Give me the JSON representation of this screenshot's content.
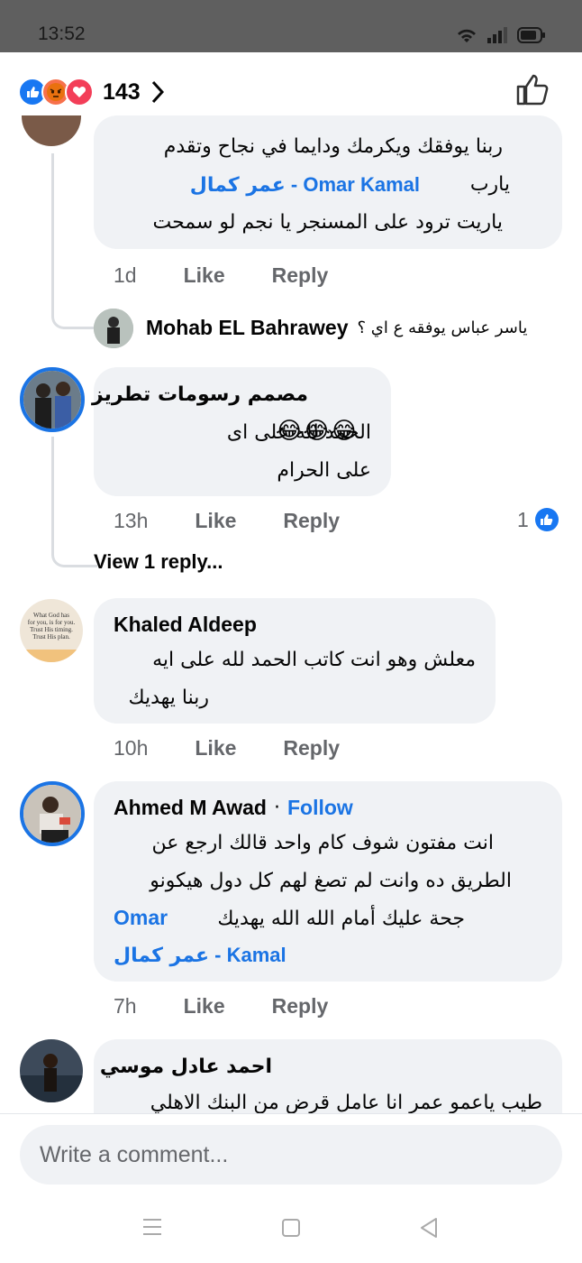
{
  "status": {
    "time": "13:52"
  },
  "header": {
    "reaction_count": "143",
    "reactions": [
      "like",
      "angry",
      "love"
    ]
  },
  "comments": [
    {
      "lines": [
        "ربنا يوفقك ويكرمك ودايما في نجاح وتقدم",
        "يارب",
        "عمر كمال",
        "ياريت ترود على المسنجر يا نجم لو سمحت"
      ],
      "mention_en": "Omar Kamal",
      "mention_sep": " - ",
      "time": "1d",
      "like": "Like",
      "reply": "Reply"
    },
    {
      "reply_author": "Mohab EL Bahrawey",
      "reply_text": "ياسر عباس يوفقه ع اي ؟"
    },
    {
      "author": "مصمم رسومات تطريز",
      "lines": [
        "الحمد لله على اى",
        "على الحرام"
      ],
      "emoji": "😂😂😂",
      "time": "13h",
      "like": "Like",
      "reply": "Reply",
      "like_count": "1",
      "view_replies": "View 1 reply..."
    },
    {
      "author": "Khaled Aldeep",
      "lines": [
        "معلش وهو انت كاتب الحمد لله على ايه",
        "ربنا يهديك"
      ],
      "time": "10h",
      "like": "Like",
      "reply": "Reply",
      "avatar_text": [
        "What God has",
        "for you, is for you.",
        "Trust His timing.",
        "Trust His plan."
      ]
    },
    {
      "author": "Ahmed M Awad",
      "follow": "Follow",
      "dot": "·",
      "lines": [
        "انت مفتون شوف كام واحد قالك ارجع عن",
        "الطريق ده وانت لم تصغ لهم كل دول هيكونو",
        "جحة عليك أمام الله الله يهديك"
      ],
      "mention_en_1": "Omar",
      "mention_en_2": "Kamal",
      "mention_ar": "عمر كمال",
      "mention_sep": " - ",
      "time": "7h",
      "like": "Like",
      "reply": "Reply"
    },
    {
      "author": "احمد عادل موسي",
      "lines": [
        "طيب ياعمو عمر انا عامل قرض من البنك الاهلي"
      ]
    }
  ],
  "composer": {
    "placeholder": "Write a comment..."
  },
  "colors": {
    "accent": "#1b74e4",
    "bubble": "#f0f2f5",
    "meta": "#65676b"
  }
}
